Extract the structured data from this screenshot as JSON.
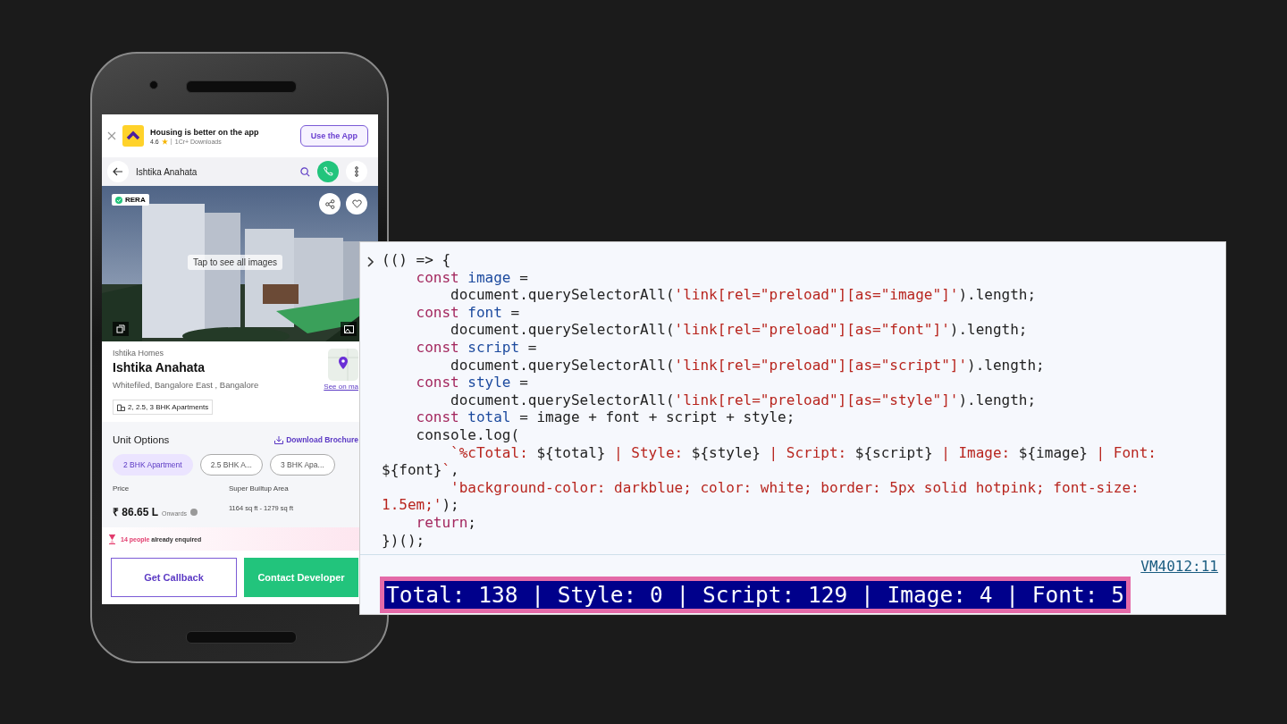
{
  "phone": {
    "app_banner": {
      "title": "Housing is better on the app",
      "rating": "4.6",
      "downloads": "1Cr+ Downloads",
      "button": "Use the App"
    },
    "header": {
      "title": "Ishtika Anahata"
    },
    "gallery": {
      "badge": "RERA",
      "hint": "Tap to see all images"
    },
    "project": {
      "developer": "Ishtika Homes",
      "name": "Ishtika Anahata",
      "location": "Whitefiled, Bangalore East , Bangalore",
      "map_link": "See on ma",
      "tag": "2, 2.5, 3 BHK Apartments"
    },
    "unit_options": {
      "title": "Unit Options",
      "download": "Download Brochure",
      "chips": [
        {
          "label": "2 BHK Apartment",
          "selected": true
        },
        {
          "label": "2.5 BHK A...",
          "selected": false
        },
        {
          "label": "3 BHK Apa...",
          "selected": false
        }
      ]
    },
    "price": {
      "label": "Price",
      "value": "₹ 86.65 L",
      "suffix": "Onwards",
      "area_label": "Super Builtup Area",
      "area": "1164 sq ft - 1279 sq ft"
    },
    "enquiry": {
      "count": "14 people",
      "text": "already enquired"
    },
    "buttons": [
      "Get Callback",
      "Contact Developer"
    ]
  },
  "console": {
    "code_lines": [
      [
        {
          "kind": "plain",
          "text": "(() => {"
        }
      ],
      [
        {
          "kind": "keyword",
          "text": "    const "
        },
        {
          "kind": "name",
          "text": "image"
        },
        {
          "kind": "plain",
          "text": " ="
        }
      ],
      [
        {
          "kind": "plain",
          "text": "        document.querySelectorAll("
        },
        {
          "kind": "string",
          "text": "'link[rel=\"preload\"][as=\"image\"]'"
        },
        {
          "kind": "plain",
          "text": ").length;"
        }
      ],
      [
        {
          "kind": "keyword",
          "text": "    const "
        },
        {
          "kind": "name",
          "text": "font"
        },
        {
          "kind": "plain",
          "text": " ="
        }
      ],
      [
        {
          "kind": "plain",
          "text": "        document.querySelectorAll("
        },
        {
          "kind": "string",
          "text": "'link[rel=\"preload\"][as=\"font\"]'"
        },
        {
          "kind": "plain",
          "text": ").length;"
        }
      ],
      [
        {
          "kind": "keyword",
          "text": "    const "
        },
        {
          "kind": "name",
          "text": "script"
        },
        {
          "kind": "plain",
          "text": " ="
        }
      ],
      [
        {
          "kind": "plain",
          "text": "        document.querySelectorAll("
        },
        {
          "kind": "string",
          "text": "'link[rel=\"preload\"][as=\"script\"]'"
        },
        {
          "kind": "plain",
          "text": ").length;"
        }
      ],
      [
        {
          "kind": "keyword",
          "text": "    const "
        },
        {
          "kind": "name",
          "text": "style"
        },
        {
          "kind": "plain",
          "text": " ="
        }
      ],
      [
        {
          "kind": "plain",
          "text": "        document.querySelectorAll("
        },
        {
          "kind": "string",
          "text": "'link[rel=\"preload\"][as=\"style\"]'"
        },
        {
          "kind": "plain",
          "text": ").length;"
        }
      ],
      [
        {
          "kind": "keyword",
          "text": "    const "
        },
        {
          "kind": "name",
          "text": "total"
        },
        {
          "kind": "plain",
          "text": " = image + font + script + style;"
        }
      ],
      [
        {
          "kind": "plain",
          "text": "    console.log("
        }
      ],
      [
        {
          "kind": "string",
          "text": "        `%cTotal: "
        },
        {
          "kind": "plain",
          "text": "${total}"
        },
        {
          "kind": "string",
          "text": " | Style: "
        },
        {
          "kind": "plain",
          "text": "${style}"
        },
        {
          "kind": "string",
          "text": " | Script: "
        },
        {
          "kind": "plain",
          "text": "${script}"
        },
        {
          "kind": "string",
          "text": " | Image: "
        },
        {
          "kind": "plain",
          "text": "${image}"
        },
        {
          "kind": "string",
          "text": " | Font:"
        }
      ],
      [
        {
          "kind": "plain",
          "text": "${font}"
        },
        {
          "kind": "string",
          "text": "`"
        },
        {
          "kind": "plain",
          "text": ","
        }
      ],
      [
        {
          "kind": "string",
          "text": "        'background-color: darkblue; color: white; border: 5px solid hotpink; font-size:"
        }
      ],
      [
        {
          "kind": "string",
          "text": "1.5em;'"
        },
        {
          "kind": "plain",
          "text": ");"
        }
      ],
      [
        {
          "kind": "keyword",
          "text": "    return"
        },
        {
          "kind": "plain",
          "text": ";"
        }
      ],
      [
        {
          "kind": "plain",
          "text": "})();"
        }
      ]
    ],
    "source_link": "VM4012:11",
    "output": "Total: 138 | Style: 0 | Script: 129 | Image: 4 | Font: 5"
  }
}
